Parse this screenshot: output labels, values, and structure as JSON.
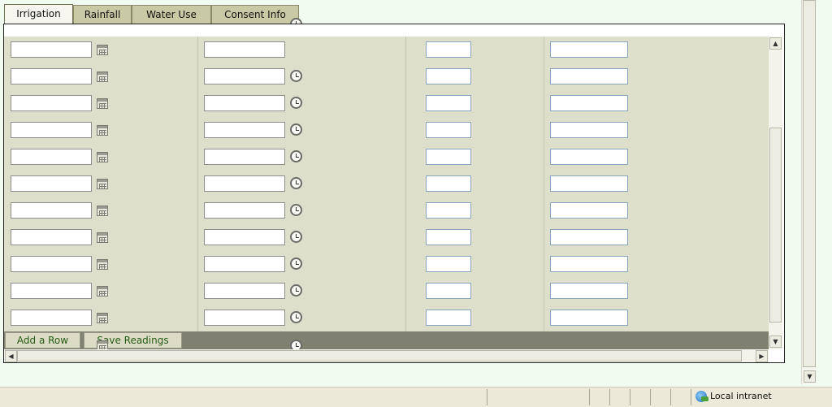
{
  "tabs": [
    {
      "label": "Irrigation",
      "active": true
    },
    {
      "label": "Rainfall",
      "active": false
    },
    {
      "label": "Water Use",
      "active": false
    },
    {
      "label": "Consent Info",
      "active": false
    }
  ],
  "grid": {
    "rows": [
      {
        "date": "",
        "time": "",
        "value1": "",
        "value2": "",
        "has_clock": false
      },
      {
        "date": "",
        "time": "",
        "value1": "",
        "value2": "",
        "has_clock": true
      },
      {
        "date": "",
        "time": "",
        "value1": "",
        "value2": "",
        "has_clock": true
      },
      {
        "date": "",
        "time": "",
        "value1": "",
        "value2": "",
        "has_clock": true
      },
      {
        "date": "",
        "time": "",
        "value1": "",
        "value2": "",
        "has_clock": true
      },
      {
        "date": "",
        "time": "",
        "value1": "",
        "value2": "",
        "has_clock": true
      },
      {
        "date": "",
        "time": "",
        "value1": "",
        "value2": "",
        "has_clock": true
      },
      {
        "date": "",
        "time": "",
        "value1": "",
        "value2": "",
        "has_clock": true
      },
      {
        "date": "",
        "time": "",
        "value1": "",
        "value2": "",
        "has_clock": true
      },
      {
        "date": "",
        "time": "",
        "value1": "",
        "value2": "",
        "has_clock": true
      },
      {
        "date": "",
        "time": "",
        "value1": "",
        "value2": "",
        "has_clock": true
      }
    ]
  },
  "buttons": {
    "add_row": "Add a Row",
    "save_readings": "Save Readings"
  },
  "statusbar": {
    "zone": "Local intranet"
  },
  "icons": {
    "calendar": "calendar-icon",
    "clock": "clock-icon",
    "zone": "globe-icon"
  },
  "colors": {
    "grid_bg": "#dedfca",
    "tab_bg": "#c9c9a6",
    "button_text": "#245a14",
    "footer_bar": "#808070"
  }
}
